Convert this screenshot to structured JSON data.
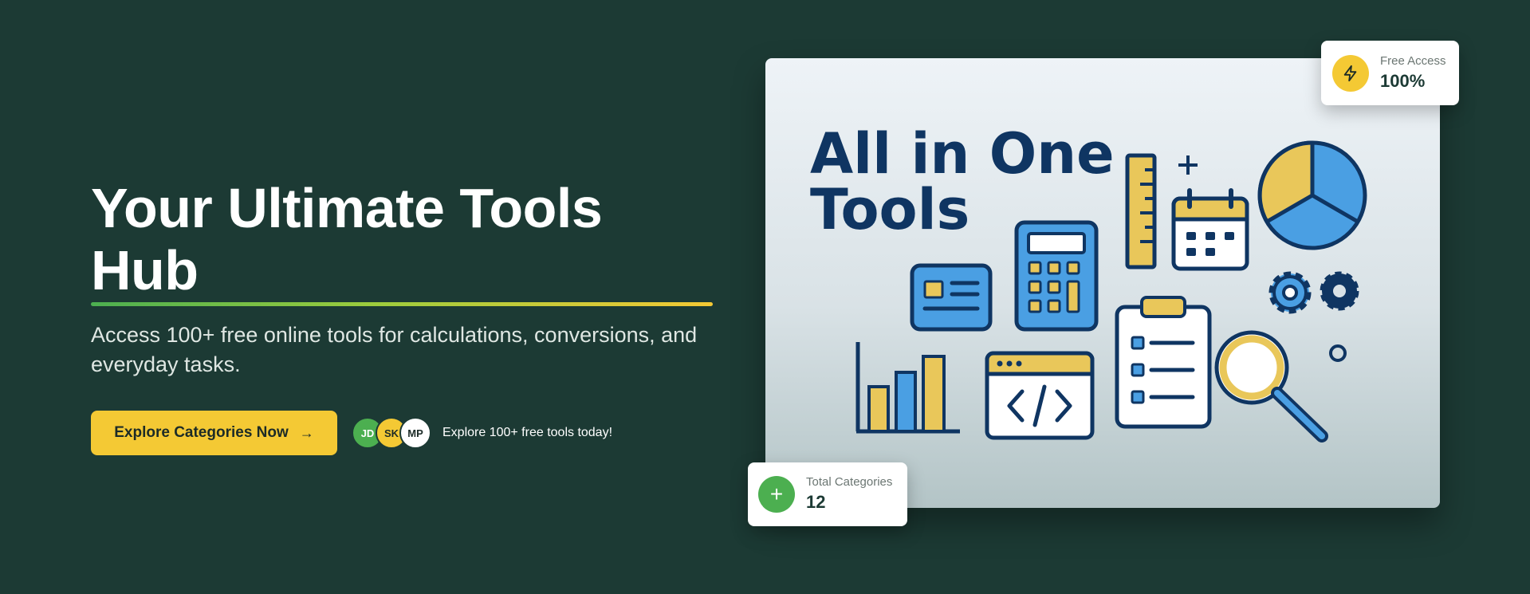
{
  "hero": {
    "title": "Your Ultimate Tools Hub",
    "subtitle": "Access 100+ free online tools for calculations, conversions, and everyday tasks.",
    "cta_label": "Explore Categories Now",
    "cta_arrow": "→",
    "avatars": [
      "JD",
      "SK",
      "MP"
    ],
    "social_text": "Explore 100+ free tools today!"
  },
  "illustration": {
    "headline_line1": "All in One",
    "headline_line2": "Tools"
  },
  "stats": {
    "free_access": {
      "label": "Free Access",
      "value": "100%",
      "icon": "lightning-icon"
    },
    "total_categories": {
      "label": "Total Categories",
      "value": "12",
      "icon": "plus-icon",
      "icon_glyph": "+"
    }
  },
  "colors": {
    "background": "#1c3a34",
    "accent_yellow": "#f4c934",
    "accent_green": "#4caf50",
    "illustration_navy": "#0f3562",
    "illustration_blue": "#4a9fe3",
    "illustration_gold": "#e9c75a"
  }
}
